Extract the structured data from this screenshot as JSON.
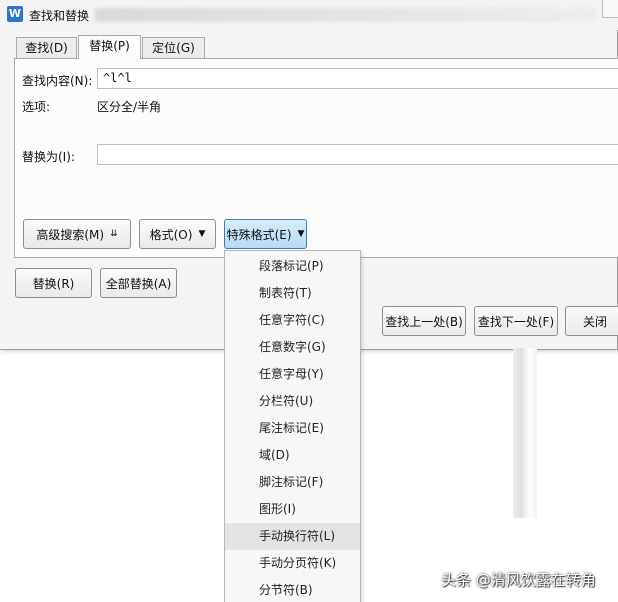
{
  "window": {
    "title": "查找和替换",
    "app_icon_glyph": "W"
  },
  "tabs": [
    {
      "label": "查找(D)",
      "active": false
    },
    {
      "label": "替换(P)",
      "active": true
    },
    {
      "label": "定位(G)",
      "active": false
    }
  ],
  "find": {
    "label": "查找内容(N):",
    "value": "^l^l"
  },
  "options": {
    "label": "选项:",
    "value": "区分全/半角"
  },
  "replace": {
    "label": "替换为(I):",
    "value": ""
  },
  "buttons": {
    "advanced_search": "高级搜索(M)",
    "format": "格式(O)",
    "special_format": "特殊格式(E)",
    "replace": "替换(R)",
    "replace_all": "全部替换(A)",
    "find_prev": "查找上一处(B)",
    "find_next": "查找下一处(F)",
    "close": "关闭"
  },
  "special_menu": [
    "段落标记(P)",
    "制表符(T)",
    "任意字符(C)",
    "任意数字(G)",
    "任意字母(Y)",
    "分栏符(U)",
    "尾注标记(E)",
    "域(D)",
    "脚注标记(F)",
    "图形(I)",
    "手动换行符(L)",
    "手动分页符(K)",
    "分节符(B)"
  ],
  "hovered_menu_item": "手动换行符(L)",
  "watermark": "头条 @清风饮露在转角",
  "colors": {
    "accent": "#2f74d0",
    "pressed_button": "#b6dcf5"
  },
  "icons": {
    "advanced_search": "double-chevron-down-icon",
    "dropdown": "triangle-down-icon"
  }
}
